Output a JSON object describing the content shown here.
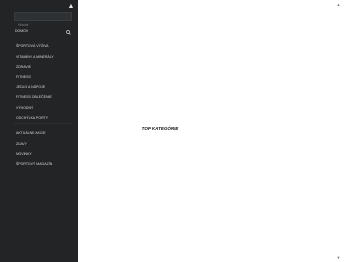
{
  "sidebar": {
    "search": {
      "placeholder": "Hľadať"
    },
    "home_label": "DOMOV",
    "items": [
      {
        "label": "ŠPORTOVÁ VÝŽIVA"
      },
      {
        "label": "VITAMÍNY A MINERÁLY"
      },
      {
        "label": "ZDRAVIE"
      },
      {
        "label": "FITNESS"
      },
      {
        "label": "JEDLO A NÁPOJE"
      },
      {
        "label": "FITNESS OBLEČENIE"
      },
      {
        "label": "VÝHODNÝ"
      },
      {
        "label": "ODCHÝLKA PORTY"
      },
      {
        "label": "AKTUÁLNE AKCIE"
      },
      {
        "label": "ZĽAVY"
      },
      {
        "label": "NOVINKY"
      },
      {
        "label": "ŠPORTOVÝ MAGAZÍN"
      }
    ]
  },
  "main": {
    "title": "TOP KATEGÓRIE"
  },
  "icons": {
    "close": "close-icon",
    "search": "search-icon",
    "scroll_up": "scroll-up-icon",
    "scroll_down": "scroll-down-icon"
  },
  "colors": {
    "sidebar_bg": "#222426",
    "sidebar_text": "#d9d9d9",
    "page_bg": "#ffffff"
  }
}
